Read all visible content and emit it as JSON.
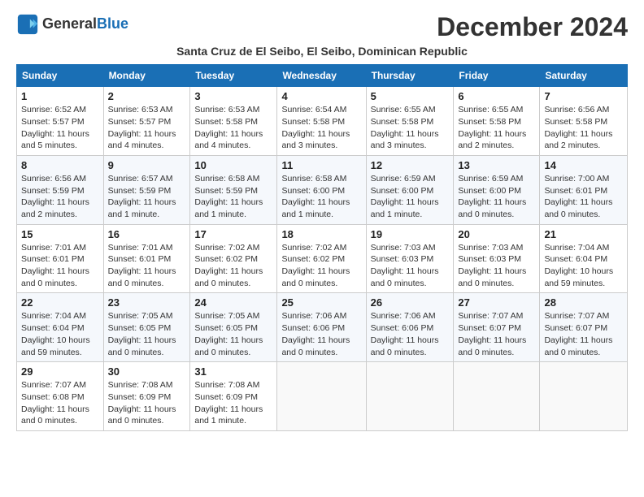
{
  "logo": {
    "line1": "General",
    "line2": "Blue"
  },
  "title": "December 2024",
  "location": "Santa Cruz de El Seibo, El Seibo, Dominican Republic",
  "days_of_week": [
    "Sunday",
    "Monday",
    "Tuesday",
    "Wednesday",
    "Thursday",
    "Friday",
    "Saturday"
  ],
  "weeks": [
    [
      {
        "day": 1,
        "sunrise": "6:52 AM",
        "sunset": "5:57 PM",
        "daylight": "11 hours and 5 minutes."
      },
      {
        "day": 2,
        "sunrise": "6:53 AM",
        "sunset": "5:57 PM",
        "daylight": "11 hours and 4 minutes."
      },
      {
        "day": 3,
        "sunrise": "6:53 AM",
        "sunset": "5:58 PM",
        "daylight": "11 hours and 4 minutes."
      },
      {
        "day": 4,
        "sunrise": "6:54 AM",
        "sunset": "5:58 PM",
        "daylight": "11 hours and 3 minutes."
      },
      {
        "day": 5,
        "sunrise": "6:55 AM",
        "sunset": "5:58 PM",
        "daylight": "11 hours and 3 minutes."
      },
      {
        "day": 6,
        "sunrise": "6:55 AM",
        "sunset": "5:58 PM",
        "daylight": "11 hours and 2 minutes."
      },
      {
        "day": 7,
        "sunrise": "6:56 AM",
        "sunset": "5:58 PM",
        "daylight": "11 hours and 2 minutes."
      }
    ],
    [
      {
        "day": 8,
        "sunrise": "6:56 AM",
        "sunset": "5:59 PM",
        "daylight": "11 hours and 2 minutes."
      },
      {
        "day": 9,
        "sunrise": "6:57 AM",
        "sunset": "5:59 PM",
        "daylight": "11 hours and 1 minute."
      },
      {
        "day": 10,
        "sunrise": "6:58 AM",
        "sunset": "5:59 PM",
        "daylight": "11 hours and 1 minute."
      },
      {
        "day": 11,
        "sunrise": "6:58 AM",
        "sunset": "6:00 PM",
        "daylight": "11 hours and 1 minute."
      },
      {
        "day": 12,
        "sunrise": "6:59 AM",
        "sunset": "6:00 PM",
        "daylight": "11 hours and 1 minute."
      },
      {
        "day": 13,
        "sunrise": "6:59 AM",
        "sunset": "6:00 PM",
        "daylight": "11 hours and 0 minutes."
      },
      {
        "day": 14,
        "sunrise": "7:00 AM",
        "sunset": "6:01 PM",
        "daylight": "11 hours and 0 minutes."
      }
    ],
    [
      {
        "day": 15,
        "sunrise": "7:01 AM",
        "sunset": "6:01 PM",
        "daylight": "11 hours and 0 minutes."
      },
      {
        "day": 16,
        "sunrise": "7:01 AM",
        "sunset": "6:01 PM",
        "daylight": "11 hours and 0 minutes."
      },
      {
        "day": 17,
        "sunrise": "7:02 AM",
        "sunset": "6:02 PM",
        "daylight": "11 hours and 0 minutes."
      },
      {
        "day": 18,
        "sunrise": "7:02 AM",
        "sunset": "6:02 PM",
        "daylight": "11 hours and 0 minutes."
      },
      {
        "day": 19,
        "sunrise": "7:03 AM",
        "sunset": "6:03 PM",
        "daylight": "11 hours and 0 minutes."
      },
      {
        "day": 20,
        "sunrise": "7:03 AM",
        "sunset": "6:03 PM",
        "daylight": "11 hours and 0 minutes."
      },
      {
        "day": 21,
        "sunrise": "7:04 AM",
        "sunset": "6:04 PM",
        "daylight": "10 hours and 59 minutes."
      }
    ],
    [
      {
        "day": 22,
        "sunrise": "7:04 AM",
        "sunset": "6:04 PM",
        "daylight": "10 hours and 59 minutes."
      },
      {
        "day": 23,
        "sunrise": "7:05 AM",
        "sunset": "6:05 PM",
        "daylight": "11 hours and 0 minutes."
      },
      {
        "day": 24,
        "sunrise": "7:05 AM",
        "sunset": "6:05 PM",
        "daylight": "11 hours and 0 minutes."
      },
      {
        "day": 25,
        "sunrise": "7:06 AM",
        "sunset": "6:06 PM",
        "daylight": "11 hours and 0 minutes."
      },
      {
        "day": 26,
        "sunrise": "7:06 AM",
        "sunset": "6:06 PM",
        "daylight": "11 hours and 0 minutes."
      },
      {
        "day": 27,
        "sunrise": "7:07 AM",
        "sunset": "6:07 PM",
        "daylight": "11 hours and 0 minutes."
      },
      {
        "day": 28,
        "sunrise": "7:07 AM",
        "sunset": "6:07 PM",
        "daylight": "11 hours and 0 minutes."
      }
    ],
    [
      {
        "day": 29,
        "sunrise": "7:07 AM",
        "sunset": "6:08 PM",
        "daylight": "11 hours and 0 minutes."
      },
      {
        "day": 30,
        "sunrise": "7:08 AM",
        "sunset": "6:09 PM",
        "daylight": "11 hours and 0 minutes."
      },
      {
        "day": 31,
        "sunrise": "7:08 AM",
        "sunset": "6:09 PM",
        "daylight": "11 hours and 1 minute."
      },
      null,
      null,
      null,
      null
    ]
  ]
}
